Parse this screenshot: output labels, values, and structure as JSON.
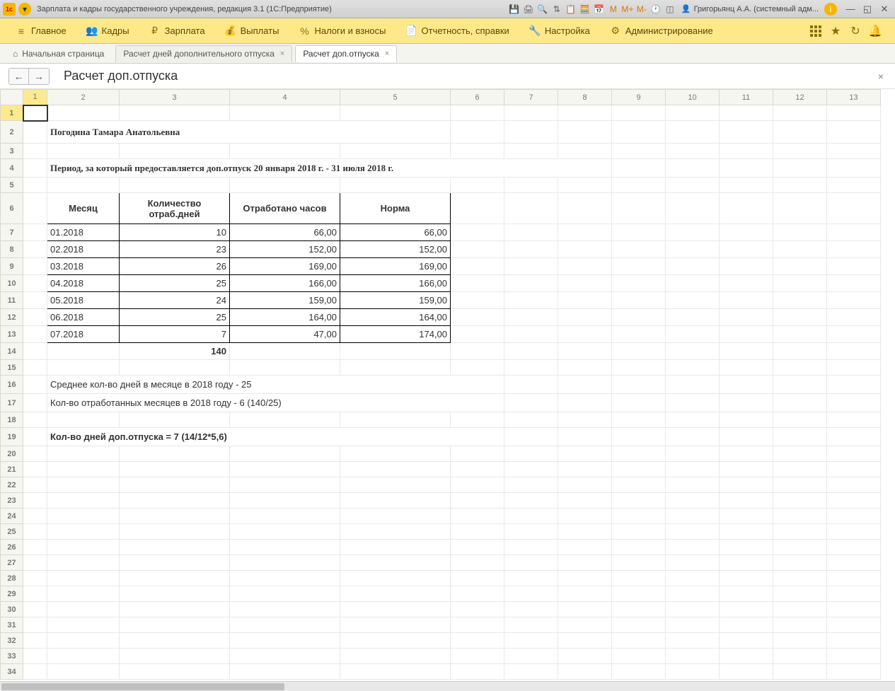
{
  "titlebar": {
    "title": "Зарплата и кадры государственного учреждения, редакция 3.1  (1С:Предприятие)",
    "user": "Григорьянц А.А. (системный адм..."
  },
  "nav": {
    "items": [
      {
        "icon": "≡",
        "label": "Главное"
      },
      {
        "icon": "👥",
        "label": "Кадры"
      },
      {
        "icon": "₽",
        "label": "Зарплата"
      },
      {
        "icon": "💰",
        "label": "Выплаты"
      },
      {
        "icon": "%",
        "label": "Налоги и взносы"
      },
      {
        "icon": "📄",
        "label": "Отчетность, справки"
      },
      {
        "icon": "🔧",
        "label": "Настройка"
      },
      {
        "icon": "⚙",
        "label": "Администрирование"
      }
    ]
  },
  "tabs": {
    "home": "Начальная страница",
    "t1": "Расчет дней дополнительного отпуска",
    "t2": "Расчет доп.отпуска"
  },
  "page": {
    "title": "Расчет доп.отпуска"
  },
  "report": {
    "name": "Погодина Тамара Анатольевна",
    "period": "Период, за который предоставляется доп.отпуск  20 января 2018 г.  -  31 июля 2018 г.",
    "headers": {
      "c1": "Месяц",
      "c2": "Количество отраб.дней",
      "c3": "Отработано часов",
      "c4": "Норма"
    },
    "rows": [
      {
        "m": "01.2018",
        "d": "10",
        "h": "66,00",
        "n": "66,00"
      },
      {
        "m": "02.2018",
        "d": "23",
        "h": "152,00",
        "n": "152,00"
      },
      {
        "m": "03.2018",
        "d": "26",
        "h": "169,00",
        "n": "169,00"
      },
      {
        "m": "04.2018",
        "d": "25",
        "h": "166,00",
        "n": "166,00"
      },
      {
        "m": "05.2018",
        "d": "24",
        "h": "159,00",
        "n": "159,00"
      },
      {
        "m": "06.2018",
        "d": "25",
        "h": "164,00",
        "n": "164,00"
      },
      {
        "m": "07.2018",
        "d": "7",
        "h": "47,00",
        "n": "174,00"
      }
    ],
    "total": "140",
    "calc1": "Среднее кол-во дней в месяце в 2018 году - 25",
    "calc2": "Кол-во отработанных месяцев в 2018 году - 6 (140/25)",
    "result": "Кол-во дней доп.отпуска = 7 (14/12*5,6)"
  },
  "cols": [
    "1",
    "2",
    "3",
    "4",
    "5",
    "6",
    "7",
    "8",
    "9",
    "10",
    "11",
    "12",
    "13"
  ]
}
